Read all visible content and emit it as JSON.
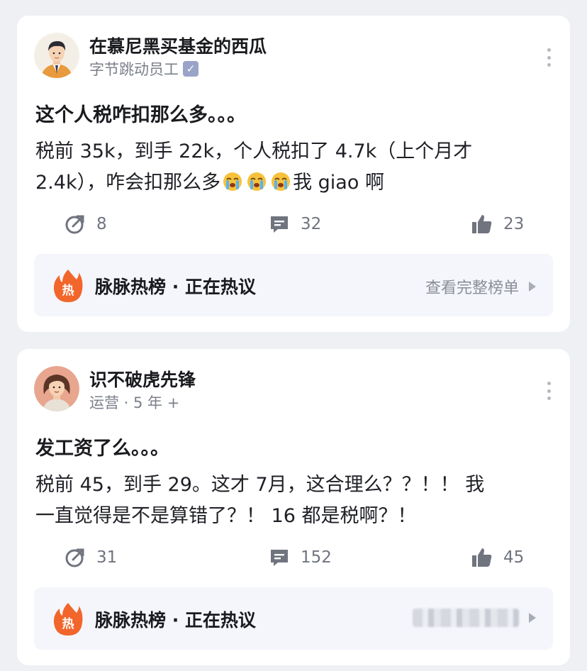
{
  "posts": [
    {
      "author": {
        "name": "在慕尼黑买基金的西瓜",
        "meta": "字节跳动员工",
        "verified": true,
        "avatar_icon": "man-in-suit-avatar"
      },
      "title": "这个人税咋扣那么多。。。",
      "body_line1": "税前 35k，到手 22k，个人税扣了 4.7k（上个月才",
      "body_line2_pre": "2.4k），咋会扣那么多",
      "body_emojis": [
        "loudly-crying-face",
        "loudly-crying-face",
        "loudly-crying-face"
      ],
      "body_line2_post": "我 giao 啊",
      "stats": {
        "shares": "8",
        "comments": "32",
        "likes": "23"
      },
      "hot": {
        "title": "脉脉热榜 · 正在热议",
        "link": "查看完整榜单"
      }
    },
    {
      "author": {
        "name": "识不破虎先锋",
        "meta": "运营 · 5 年 +",
        "verified": false,
        "avatar_icon": "woman-avatar"
      },
      "title": "发工资了么。。。",
      "body_line1": "税前 45，到手 29。这才 7月，这合理么？？！！ 我",
      "body_line2": "一直觉得是不是算错了？！ 16 都是税啊？！",
      "stats": {
        "shares": "31",
        "comments": "152",
        "likes": "45"
      },
      "hot": {
        "title": "脉脉热榜 · 正在热议",
        "link": ""
      }
    }
  ],
  "colors": {
    "background": "#eef0f4",
    "card": "#ffffff",
    "banner": "#f4f6fb",
    "fire": "#f2662b",
    "meta_text": "#7b7f8a"
  }
}
